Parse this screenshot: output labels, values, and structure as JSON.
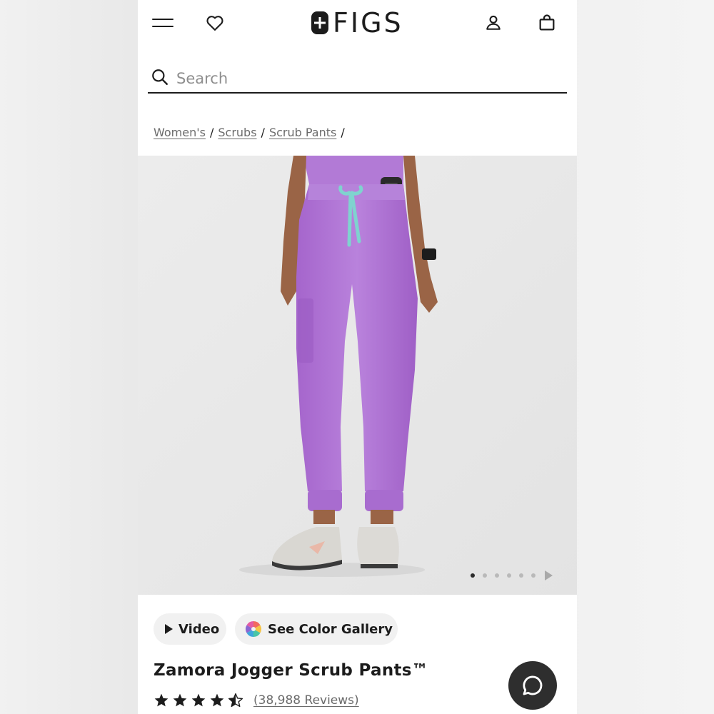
{
  "brand": {
    "logo_text": "FIGS"
  },
  "header": {
    "menu_icon": "hamburger-menu-icon",
    "wishlist_icon": "heart-icon",
    "account_icon": "user-icon",
    "bag_icon": "shopping-bag-icon"
  },
  "search": {
    "placeholder": "Search",
    "value": ""
  },
  "breadcrumb": {
    "items": [
      "Women's",
      "Scrubs",
      "Scrub Pants"
    ],
    "separator": "/"
  },
  "gallery": {
    "slide_count": 6,
    "active_slide": 1
  },
  "actions": {
    "video_label": "Video",
    "color_gallery_label": "See Color Gallery"
  },
  "product": {
    "title": "Zamora Jogger Scrub Pants™",
    "rating": 4.5,
    "max_rating": 5,
    "reviews_text": "(38,988 Reviews)"
  },
  "colors": {
    "pant_color": "#b27ad6",
    "drawstring_color": "#7fd3cf",
    "chat_button": "#2e2e2e"
  }
}
